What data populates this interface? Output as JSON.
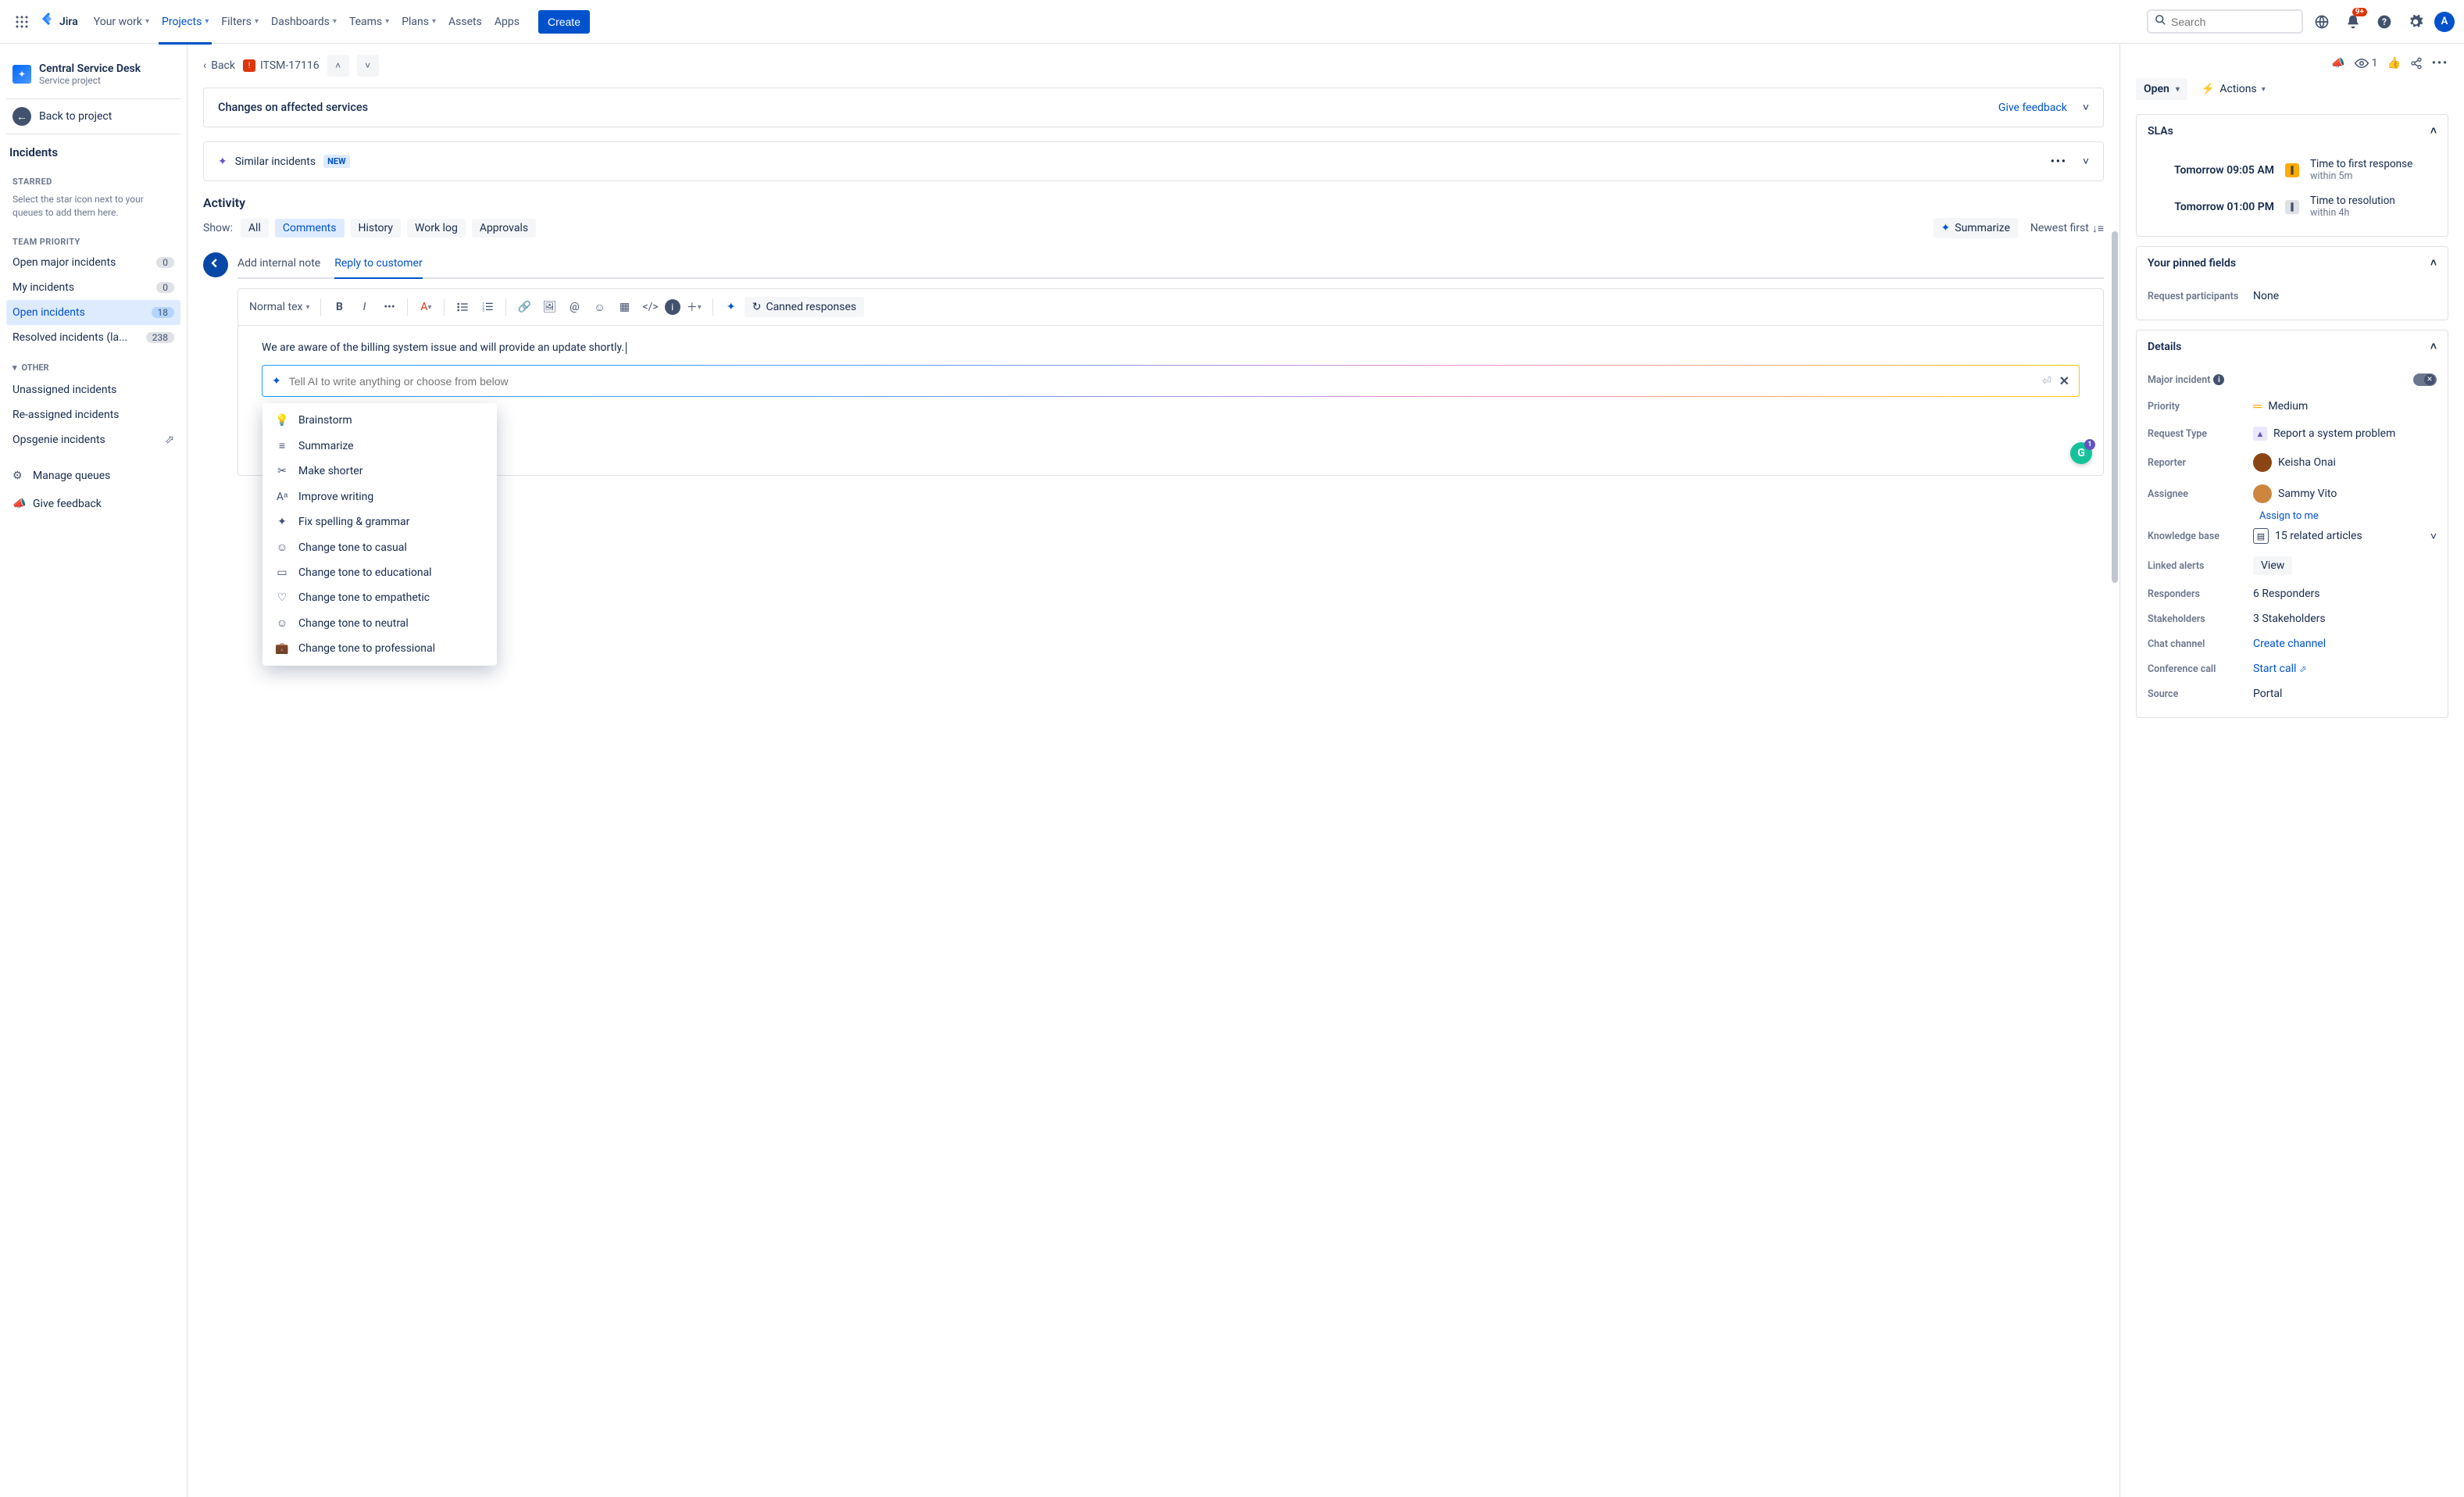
{
  "nav": {
    "product": "Jira",
    "items": [
      "Your work",
      "Projects",
      "Filters",
      "Dashboards",
      "Teams",
      "Plans",
      "Assets",
      "Apps"
    ],
    "active_index": 1,
    "create": "Create",
    "search_placeholder": "Search",
    "notification_badge": "9+"
  },
  "sidebar": {
    "project_name": "Central Service Desk",
    "project_type": "Service project",
    "back_to_project": "Back to project",
    "section_title": "Incidents",
    "starred_hdr": "STARRED",
    "starred_hint": "Select the star icon next to your queues to add them here.",
    "team_hdr": "TEAM PRIORITY",
    "queues": [
      {
        "label": "Open major incidents",
        "count": "0",
        "active": false
      },
      {
        "label": "My incidents",
        "count": "0",
        "active": false
      },
      {
        "label": "Open incidents",
        "count": "18",
        "active": true
      },
      {
        "label": "Resolved incidents (la...",
        "count": "238",
        "active": false
      }
    ],
    "other_hdr": "OTHER",
    "other_items": [
      "Unassigned incidents",
      "Re-assigned incidents",
      "Opsgenie incidents"
    ],
    "manage_queues": "Manage queues",
    "give_feedback": "Give feedback"
  },
  "main": {
    "back": "Back",
    "issue_key": "ITSM-17116",
    "affected_title": "Changes on affected services",
    "give_feedback": "Give feedback",
    "similar_incidents": "Similar incidents",
    "new_pill": "NEW",
    "activity": "Activity",
    "show_label": "Show:",
    "filters": [
      "All",
      "Comments",
      "History",
      "Work log",
      "Approvals"
    ],
    "filter_active_index": 1,
    "summarize": "Summarize",
    "sort": "Newest first",
    "tabs": {
      "internal": "Add internal note",
      "reply": "Reply to customer"
    },
    "toolbar": {
      "textstyle": "Normal tex",
      "canned": "Canned responses"
    },
    "body_text": "We are aware of the billing system issue and will provide an update shortly.",
    "ai_placeholder": "Tell AI to write anything or choose from below",
    "ai_options": [
      "Brainstorm",
      "Summarize",
      "Make shorter",
      "Improve writing",
      "Fix spelling & grammar",
      "Change tone to casual",
      "Change tone to educational",
      "Change tone to empathetic",
      "Change tone to neutral",
      "Change tone to professional"
    ]
  },
  "details": {
    "watchers": "1",
    "status": "Open",
    "actions": "Actions",
    "slas_hdr": "SLAs",
    "slas": [
      {
        "time": "Tomorrow 09:05 AM",
        "badge": "amber",
        "title": "Time to first response",
        "sub": "within 5m"
      },
      {
        "time": "Tomorrow 01:00 PM",
        "badge": "grey",
        "title": "Time to resolution",
        "sub": "within 4h"
      }
    ],
    "pinned_hdr": "Your pinned fields",
    "pinned": {
      "label": "Request participants",
      "value": "None"
    },
    "details_hdr": "Details",
    "fields": {
      "major_incident": "Major incident",
      "priority_label": "Priority",
      "priority_value": "Medium",
      "request_type_label": "Request Type",
      "request_type_value": "Report a system problem",
      "reporter_label": "Reporter",
      "reporter_value": "Keisha Onai",
      "assignee_label": "Assignee",
      "assignee_value": "Sammy Vito",
      "assign_to_me": "Assign to me",
      "kb_label": "Knowledge base",
      "kb_value": "15 related articles",
      "linked_alerts_label": "Linked alerts",
      "linked_alerts_value": "View",
      "responders_label": "Responders",
      "responders_value": "6 Responders",
      "stakeholders_label": "Stakeholders",
      "stakeholders_value": "3 Stakeholders",
      "chat_label": "Chat channel",
      "chat_value": "Create channel",
      "conf_label": "Conference call",
      "conf_value": "Start call",
      "source_label": "Source",
      "source_value": "Portal"
    }
  }
}
